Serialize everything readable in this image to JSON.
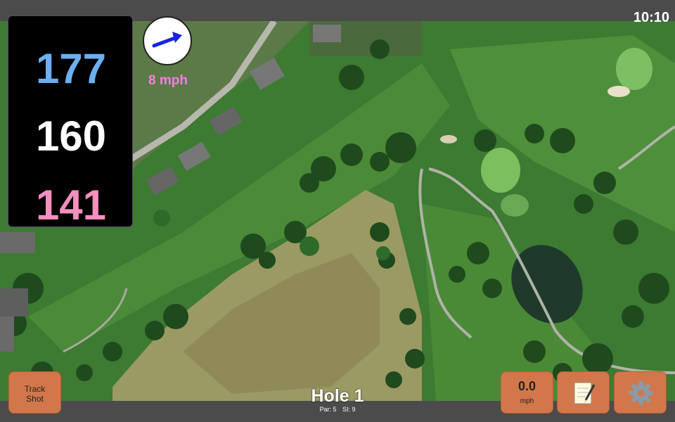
{
  "status_bar": {
    "time": "10:10"
  },
  "yardage": {
    "back": "177",
    "middle": "160",
    "front": "141"
  },
  "wind": {
    "speed_label": "8 mph",
    "direction_icon": "arrow-right-icon"
  },
  "buttons": {
    "track_shot_line1": "Track",
    "track_shot_line2": "Shot",
    "speed_value": "0.0",
    "speed_unit": "mph",
    "notes_icon": "notepad-icon",
    "settings_icon": "gear-icon"
  },
  "hole": {
    "title": "Hole 1",
    "par": "Par: 5",
    "si": "SI: 9"
  },
  "colors": {
    "back_yardage": "#6bb0f2",
    "middle_yardage": "#ffffff",
    "front_yardage": "#f58fbf",
    "wind_speed": "#f47fe0",
    "button": "#d2774a"
  }
}
